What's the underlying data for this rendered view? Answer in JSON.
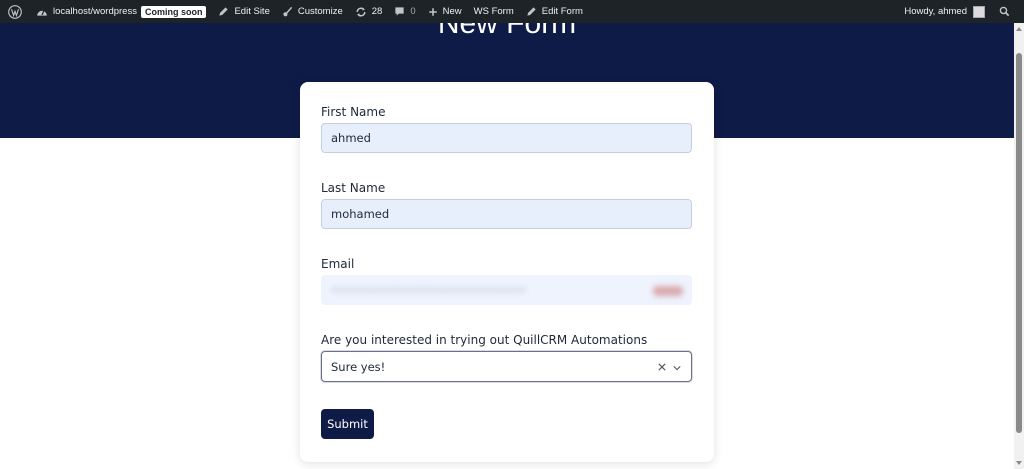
{
  "adminbar": {
    "site": "localhost/wordpress",
    "badge": "Coming soon",
    "edit_site": "Edit Site",
    "customize": "Customize",
    "updates_count": "28",
    "comments_count": "0",
    "new": "New",
    "ws_form": "WS Form",
    "edit_form": "Edit Form",
    "howdy": "Howdy, ahmed"
  },
  "hero": {
    "title": "New Form"
  },
  "form": {
    "first_name": {
      "label": "First Name",
      "value": "ahmed"
    },
    "last_name": {
      "label": "Last Name",
      "value": "mohamed"
    },
    "email": {
      "label": "Email",
      "value": "••••••••••••••••••••••••••••••"
    },
    "interest": {
      "label": "Are you interested in trying out QuillCRM Automations",
      "selected": "Sure yes!"
    },
    "submit_label": "Submit"
  },
  "colors": {
    "adminbar_bg": "#1d2327",
    "hero_bg": "#0f1b47",
    "input_bg": "#e8effc",
    "button_bg": "#0f1b47"
  }
}
